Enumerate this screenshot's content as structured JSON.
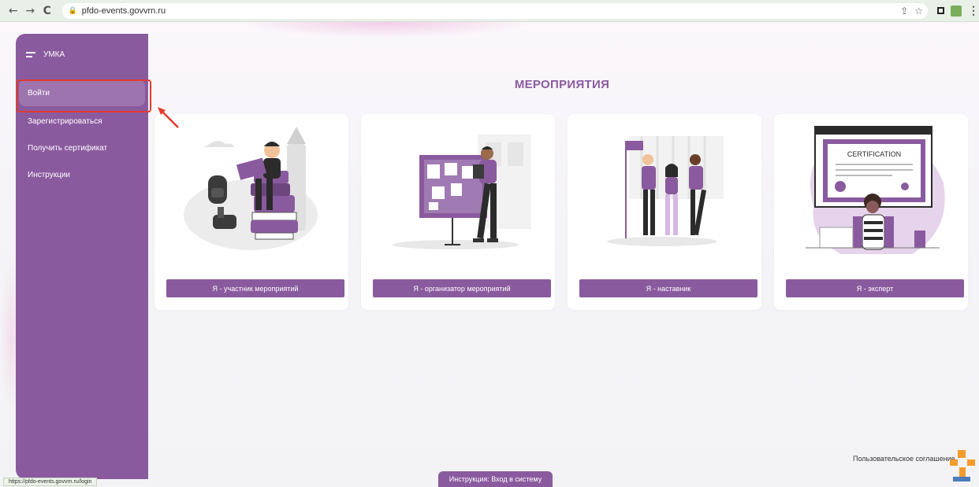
{
  "browser": {
    "url": "pfdo-events.govvrn.ru",
    "back_icon": "←",
    "forward_icon": "→",
    "reload_icon": "C",
    "share_icon": "⇪",
    "star_icon": "☆",
    "more_icon": "⋮"
  },
  "sidebar": {
    "app_name": "УМКА",
    "items": [
      {
        "label": "Войти"
      },
      {
        "label": "Зарегистрироваться"
      },
      {
        "label": "Получить сертификат"
      },
      {
        "label": "Инструкции"
      }
    ]
  },
  "main": {
    "title": "МЕРОПРИЯТИЯ",
    "cards": [
      {
        "button": "Я - участник мероприятий"
      },
      {
        "button": "Я - организатор мероприятий"
      },
      {
        "button": "Я - наставник"
      },
      {
        "button": "Я - эксперт",
        "certificate_text": "CERTIFICATION"
      }
    ]
  },
  "footer": {
    "status_url": "https://pfdo-events.govvrn.ru/login",
    "instruction_button": "Инструкция: Вход в систему",
    "agreement": "Пользовательское соглашение"
  },
  "colors": {
    "brand": "#8a5a9e",
    "highlight": "#e33a2c"
  }
}
